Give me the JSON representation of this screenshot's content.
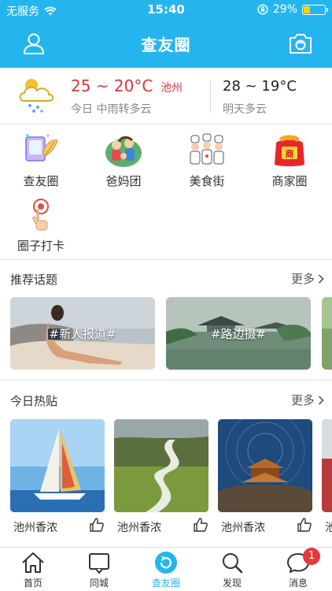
{
  "status_bar": {
    "carrier": "无服务",
    "time": "15:40",
    "battery": "29%",
    "battery_level": 0.29
  },
  "header": {
    "title": "查友圈"
  },
  "weather": {
    "today_temp": "25 ~ 20°C",
    "city": "池州",
    "today_desc": "今日 中雨转多云",
    "tomorrow_temp": "28 ~ 19°C",
    "tomorrow_desc": "明天多云"
  },
  "categories": [
    {
      "label": "查友圈",
      "icon": "chayouquan-icon"
    },
    {
      "label": "爸妈团",
      "icon": "parents-group-icon"
    },
    {
      "label": "美食街",
      "icon": "food-street-icon"
    },
    {
      "label": "商家圈",
      "icon": "merchant-icon"
    },
    {
      "label": "圈子打卡",
      "icon": "checkin-icon"
    }
  ],
  "topics_section": {
    "title": "推荐话题",
    "more": "更多",
    "cards": [
      {
        "label": "#新人报道#"
      },
      {
        "label": "#路边摄#"
      }
    ]
  },
  "hot_section": {
    "title": "今日热贴",
    "more": "更多",
    "posts": [
      {
        "name": "池州香浓"
      },
      {
        "name": "池州香浓"
      },
      {
        "name": "池州香浓"
      },
      {
        "name": "池"
      }
    ]
  },
  "tabbar": {
    "items": [
      {
        "label": "首页",
        "icon": "home-icon"
      },
      {
        "label": "同城",
        "icon": "city-icon"
      },
      {
        "label": "查友圈",
        "icon": "chayouquan-tab-icon",
        "active": true
      },
      {
        "label": "发现",
        "icon": "search-icon"
      },
      {
        "label": "消息",
        "icon": "message-icon",
        "badge": "1"
      }
    ]
  },
  "colors": {
    "brand": "#25b5ee",
    "temp_accent": "#d9363e",
    "badge": "#e5393c"
  }
}
